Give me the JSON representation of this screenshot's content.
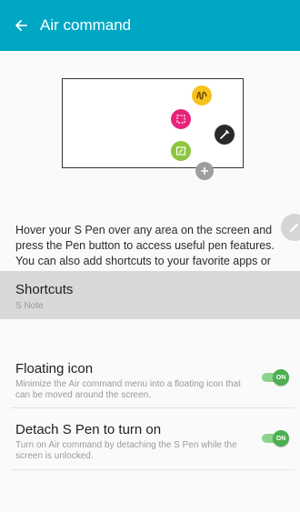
{
  "appbar": {
    "title": "Air command",
    "back_icon": "arrow-left-icon",
    "color": "#00a7c4"
  },
  "preview": {
    "menu_icons": [
      "action-memo-icon",
      "smart-select-icon",
      "screen-write-icon",
      "pen-window-icon",
      "add-shortcut-icon",
      "air-command-pen-icon"
    ]
  },
  "description": "Hover your S Pen over any area on the screen and press the Pen button to access useful pen features. You can also add shortcuts to your favorite apps or functions to open or turn them on via Air command.",
  "shortcuts": {
    "title": "Shortcuts",
    "subtitle": "S Note"
  },
  "settings": [
    {
      "title": "Floating icon",
      "subtitle": "Minimize the Air command menu into a floating icon that can be moved around the screen.",
      "toggle_label": "ON",
      "enabled": true
    },
    {
      "title": "Detach S Pen to turn on",
      "subtitle": "Turn on Air command by detaching the S Pen while the screen is unlocked.",
      "toggle_label": "ON",
      "enabled": true
    }
  ]
}
